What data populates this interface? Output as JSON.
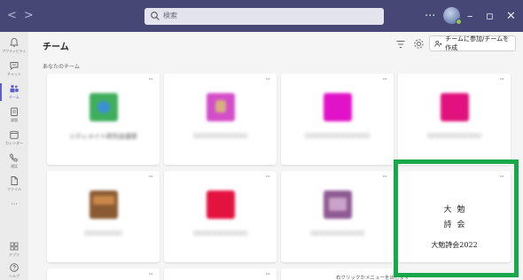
{
  "titlebar": {
    "search_placeholder": "検索",
    "more_label": "···",
    "minimize_label": "–",
    "maximize_label": "▫",
    "close_label": "✕"
  },
  "rail": {
    "items": [
      {
        "label": "アクティビティ"
      },
      {
        "label": "チャット"
      },
      {
        "label": "チーム"
      },
      {
        "label": "課題"
      },
      {
        "label": "カレンダー"
      },
      {
        "label": "通話"
      },
      {
        "label": "ファイル"
      },
      {
        "label": "···"
      },
      {
        "label": "アプリ"
      },
      {
        "label": "ヘルプ"
      }
    ]
  },
  "main": {
    "title": "チーム",
    "join_button": "チームに参加/チームを作成",
    "section_label": "あなたのチーム",
    "card_more": "···",
    "teams": [
      {
        "name": "シティメイト研究会議室",
        "tile_color": "#3fae5c",
        "accent": "#3b8fd6"
      },
      {
        "name": "○○○○○○○○○○",
        "tile_color": "#d34ec8",
        "accent": "#d7b07e"
      },
      {
        "name": "○○○○○○○○○○○○",
        "tile_color": "#e112c8",
        "accent": "#e112c8"
      },
      {
        "name": "○○○○○○○○○○",
        "tile_color": "#e1127d",
        "accent": "#e1127d"
      },
      {
        "name": "○○○○○○○",
        "tile_color": "#8a5a32",
        "accent": "#c9884a"
      },
      {
        "name": "○○○○○○○○○○",
        "tile_color": "#e4123f",
        "accent": "#e4123f"
      },
      {
        "name": "○○○○○○○○○○",
        "tile_color": "#8e5a92",
        "accent": "#c9a3c9"
      }
    ],
    "featured": {
      "line1": "大勉",
      "line2": "詩会",
      "line3": "大勉詩会2022"
    },
    "tooltip": "右クリックかメニューを出します"
  },
  "colors": {
    "titlebar": "#464775",
    "accent": "#5b5fc7",
    "highlight": "#18a74a"
  }
}
